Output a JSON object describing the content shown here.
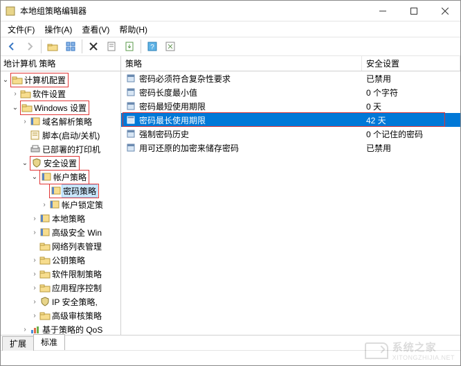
{
  "window": {
    "title": "本地组策略编辑器"
  },
  "menubar": {
    "file": "文件(F)",
    "action": "操作(A)",
    "view": "查看(V)",
    "help": "帮助(H)"
  },
  "tree": {
    "header": "地计算机 策略",
    "root": {
      "label": "计算机配置",
      "children": [
        {
          "label": "软件设置",
          "type": "folder",
          "expander": "›"
        },
        {
          "label": "Windows 设置",
          "type": "folder",
          "highlight": true,
          "expander": "⌄",
          "children": [
            {
              "label": "域名解析策略",
              "type": "book",
              "expander": "›"
            },
            {
              "label": "脚本(启动/关机)",
              "type": "scroll"
            },
            {
              "label": "已部署的打印机",
              "type": "printer"
            },
            {
              "label": "安全设置",
              "type": "shield",
              "highlight": true,
              "expander": "⌄",
              "children": [
                {
                  "label": "帐户策略",
                  "type": "book",
                  "highlight": true,
                  "expander": "⌄",
                  "children": [
                    {
                      "label": "密码策略",
                      "type": "book",
                      "selected": true,
                      "highlight": true
                    },
                    {
                      "label": "帐户锁定策",
                      "type": "book",
                      "expander": "›"
                    }
                  ]
                },
                {
                  "label": "本地策略",
                  "type": "book",
                  "expander": "›"
                },
                {
                  "label": "高级安全 Win",
                  "type": "book",
                  "expander": "›"
                },
                {
                  "label": "网络列表管理",
                  "type": "folder"
                },
                {
                  "label": "公钥策略",
                  "type": "folder",
                  "expander": "›"
                },
                {
                  "label": "软件限制策略",
                  "type": "folder",
                  "expander": "›"
                },
                {
                  "label": "应用程序控制",
                  "type": "folder",
                  "expander": "›"
                },
                {
                  "label": "IP 安全策略,",
                  "type": "shield",
                  "expander": "›"
                },
                {
                  "label": "高级审核策略",
                  "type": "folder",
                  "expander": "›"
                }
              ]
            },
            {
              "label": "基于策略的 QoS",
              "type": "chart",
              "expander": "›"
            }
          ]
        }
      ]
    }
  },
  "list": {
    "columns": {
      "policy": "策略",
      "setting": "安全设置"
    },
    "rows": [
      {
        "policy": "密码必须符合复杂性要求",
        "setting": "已禁用"
      },
      {
        "policy": "密码长度最小值",
        "setting": "0 个字符"
      },
      {
        "policy": "密码最短使用期限",
        "setting": "0 天"
      },
      {
        "policy": "密码最长使用期限",
        "setting": "42 天",
        "selected": true,
        "highlight": true
      },
      {
        "policy": "强制密码历史",
        "setting": "0 个记住的密码"
      },
      {
        "policy": "用可还原的加密来储存密码",
        "setting": "已禁用"
      }
    ]
  },
  "tabs": {
    "extended": "扩展",
    "standard": "标准"
  },
  "watermark": {
    "cn": "系统之家",
    "en": "XITONGZHIJIA.NET"
  }
}
